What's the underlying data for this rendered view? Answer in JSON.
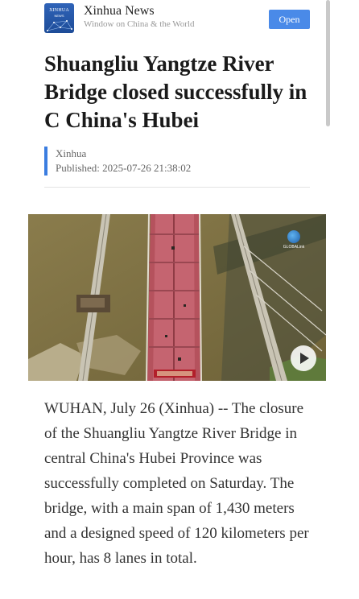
{
  "app": {
    "logo_line1": "XINHUA",
    "logo_line2": "NEWS",
    "name": "Xinhua News",
    "tagline": "Window on China & the World",
    "open_label": "Open",
    "accent_color": "#4a8ae8"
  },
  "article": {
    "title": "Shuangliu Yangtze River Bridge closed successfully in C China's Hubei",
    "source": "Xinhua",
    "published": "Published: 2025-07-26 21:38:02",
    "body": "WUHAN, July 26 (Xinhua) -- The closure of the Shuangliu Yangtze River Bridge in central China's Hubei Province was successfully completed on Saturday. The bridge, with a main span of 1,430 meters and a designed speed of 120 kilometers per hour, has 8 lanes in total."
  },
  "video": {
    "thumbnail_desc_icon": "aerial-bridge-thumbnail",
    "watermark": "GLOBALink",
    "play_icon": "play-icon"
  }
}
